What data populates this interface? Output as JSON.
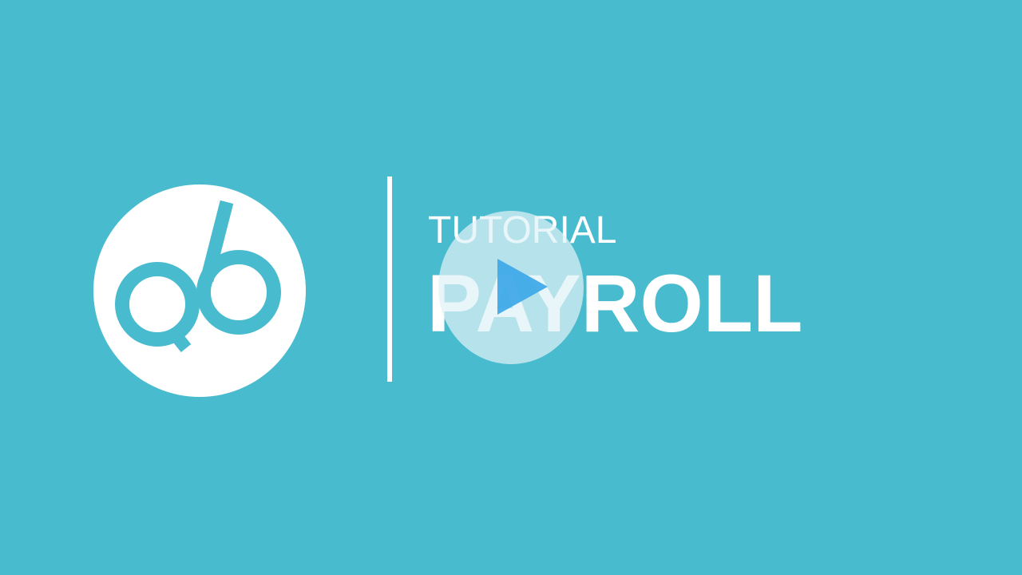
{
  "poster": {
    "subtitle": "TUTORIAL",
    "title": "PAYROLL"
  },
  "logo": {
    "icon": "q6-logo-icon"
  },
  "play_button": {
    "icon": "play-icon"
  },
  "colors": {
    "background": "#48bbce",
    "text": "#ffffff",
    "play_triangle": "#3aa6e8",
    "play_circle": "#e1f2f6"
  }
}
